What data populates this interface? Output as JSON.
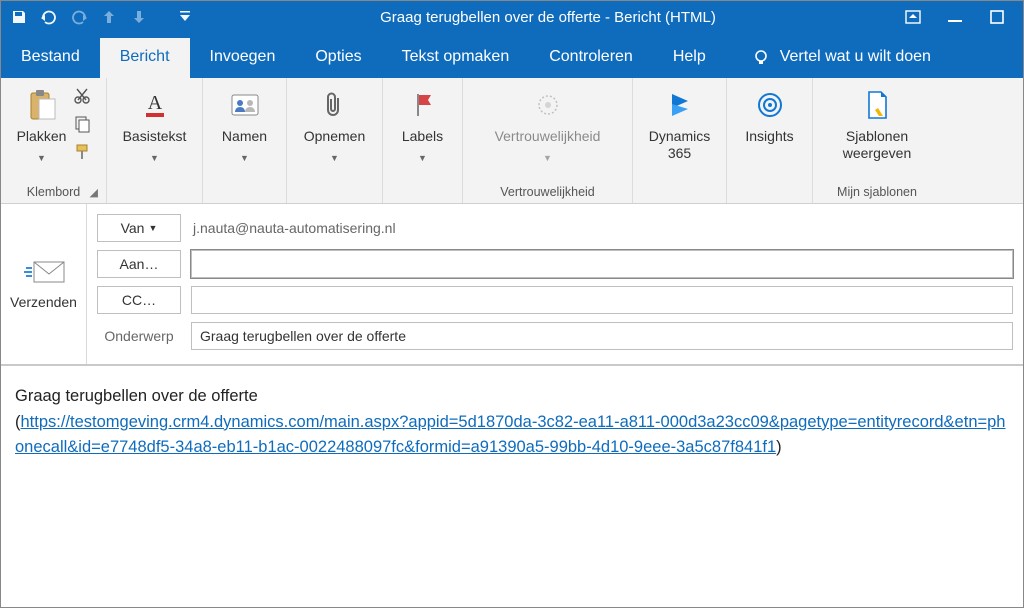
{
  "window": {
    "title": "Graag terugbellen over de offerte  -  Bericht (HTML)"
  },
  "tabs": {
    "file": "Bestand",
    "message": "Bericht",
    "insert": "Invoegen",
    "options": "Opties",
    "format": "Tekst opmaken",
    "review": "Controleren",
    "help": "Help",
    "tellme": "Vertel wat u wilt doen"
  },
  "ribbon": {
    "clipboard": {
      "paste": "Plakken",
      "group": "Klembord"
    },
    "basictext": {
      "button": "Basistekst"
    },
    "names": {
      "button": "Namen"
    },
    "include": {
      "button": "Opnemen"
    },
    "tags": {
      "button": "Labels"
    },
    "sensitivity": {
      "button": "Vertrouwelijkheid",
      "group": "Vertrouwelijkheid"
    },
    "dynamics": {
      "button": "Dynamics 365"
    },
    "insights": {
      "button": "Insights"
    },
    "templates": {
      "button": "Sjablonen weergeven",
      "group": "Mijn sjablonen"
    }
  },
  "compose": {
    "send": "Verzenden",
    "from_label": "Van",
    "from_value": "j.nauta@nauta-automatisering.nl",
    "to_label": "Aan…",
    "to_value": "",
    "cc_label": "CC…",
    "cc_value": "",
    "subject_label": "Onderwerp",
    "subject_value": "Graag terugbellen over de offerte"
  },
  "body": {
    "line1": "Graag terugbellen over de offerte",
    "paren_open": "(",
    "link_text": "https://testomgeving.crm4.dynamics.com/main.aspx?appid=5d1870da-3c82-ea11-a811-000d3a23cc09&pagetype=entityrecord&etn=phonecall&id=e7748df5-34a8-eb11-b1ac-0022488097fc&formid=a91390a5-99bb-4d10-9eee-3a5c87f841f1",
    "paren_close": ")"
  }
}
